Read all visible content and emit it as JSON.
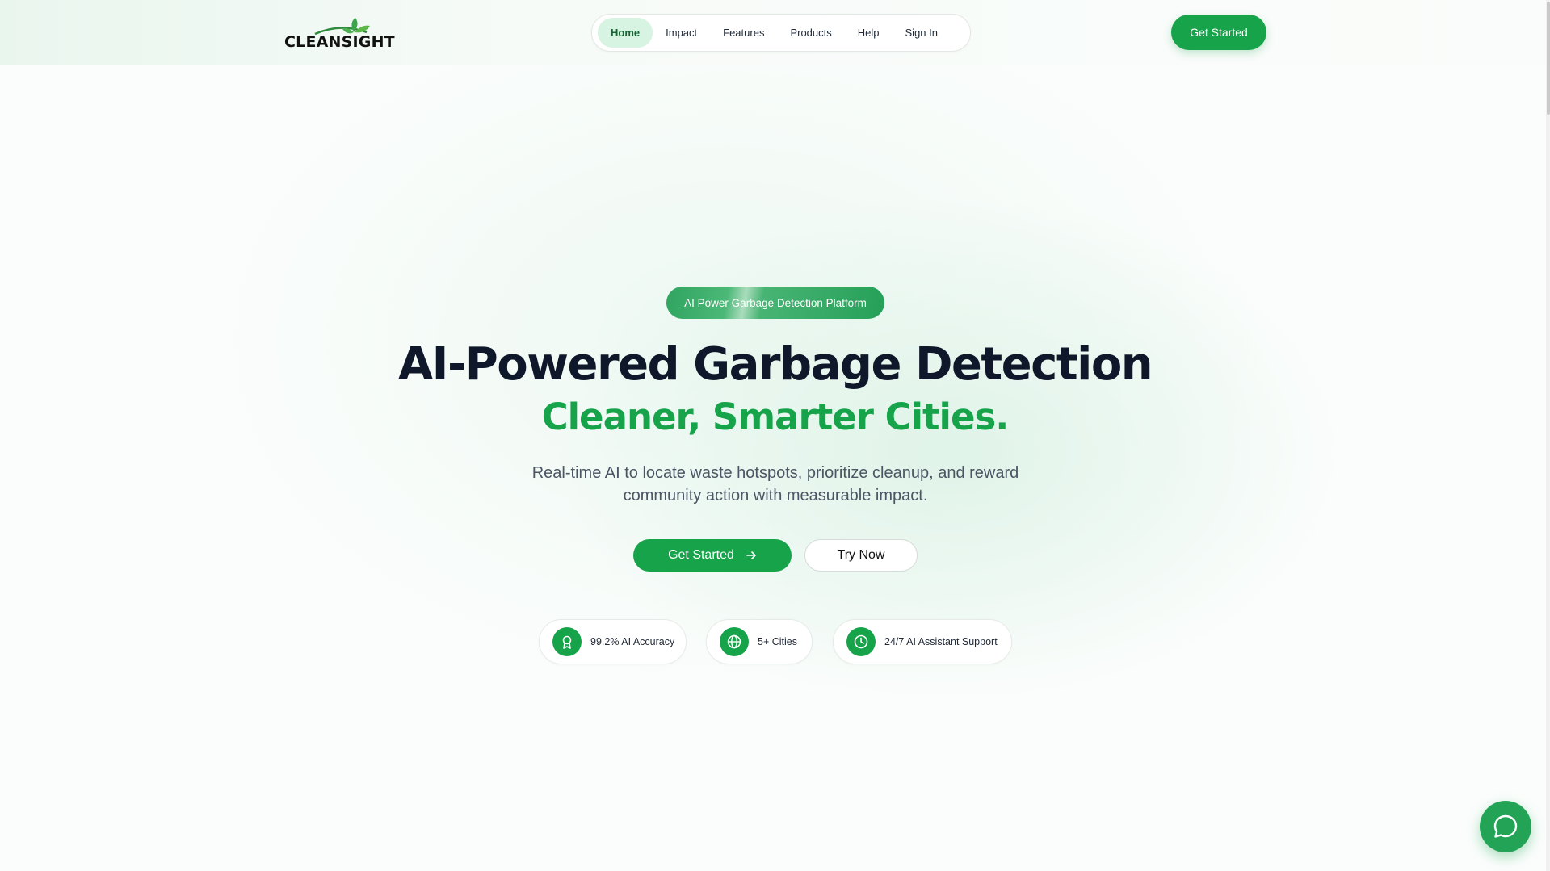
{
  "header": {
    "logo_text": "CLEANSIGHT",
    "nav": [
      {
        "label": "Home",
        "active": true
      },
      {
        "label": "Impact"
      },
      {
        "label": "Features"
      },
      {
        "label": "Products"
      },
      {
        "label": "Help"
      },
      {
        "label": "Sign In"
      }
    ],
    "cta_label": "Get Started"
  },
  "hero": {
    "badge": "AI Power Garbage Detection Platform",
    "title": "AI-Powered Garbage Detection",
    "subtitle": "Cleaner, Smarter Cities.",
    "description": "Real-time AI to locate waste hotspots, prioritize cleanup, and reward community action with measurable impact.",
    "primary_button": "Get Started",
    "secondary_button": "Try Now"
  },
  "stats": [
    {
      "icon": "award-icon",
      "label": "99.2% AI Accuracy"
    },
    {
      "icon": "globe-icon",
      "label": "5+ Cities"
    },
    {
      "icon": "clock-icon",
      "label": "24/7 AI Assistant Support"
    }
  ],
  "colors": {
    "brand_green": "#16a34a",
    "title_dark": "#0f172a",
    "nav_active_bg": "#d7f3e1"
  },
  "chat": {
    "icon": "chat-bubble-icon"
  }
}
